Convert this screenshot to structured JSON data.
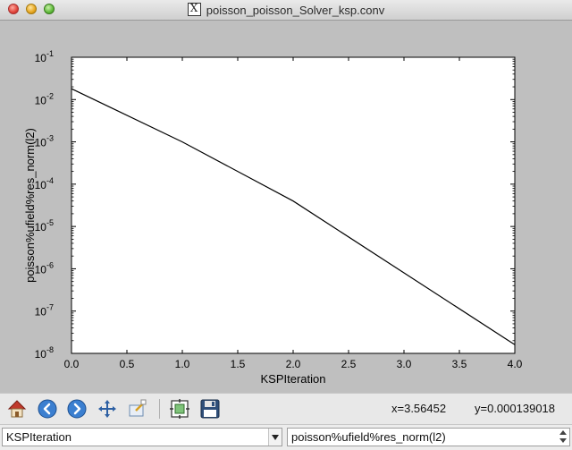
{
  "window": {
    "title": "poisson_poisson_Solver_ksp.conv"
  },
  "toolbar": {
    "coord_x": "x=3.56452",
    "coord_y": "y=0.000139018",
    "tools": [
      "home-icon",
      "back-icon",
      "forward-icon",
      "pan-icon",
      "zoom-icon",
      "configure-subplots-icon",
      "save-icon"
    ]
  },
  "selectors": {
    "x_field": "KSPIteration",
    "y_field": "poisson%ufield%res_norm(l2)"
  },
  "chart_data": {
    "type": "line",
    "xlabel": "KSPIteration",
    "ylabel": "poisson%ufield%res_norm(l2)",
    "xlim": [
      0.0,
      4.0
    ],
    "ylim": [
      1e-08,
      0.1
    ],
    "yscale": "log",
    "grid": false,
    "x_ticks": [
      "0.0",
      "0.5",
      "1.0",
      "1.5",
      "2.0",
      "2.5",
      "3.0",
      "3.5",
      "4.0"
    ],
    "y_ticks": [
      {
        "base": "10",
        "exp": "-8"
      },
      {
        "base": "10",
        "exp": "-7"
      },
      {
        "base": "10",
        "exp": "-6"
      },
      {
        "base": "10",
        "exp": "-5"
      },
      {
        "base": "10",
        "exp": "-4"
      },
      {
        "base": "10",
        "exp": "-3"
      },
      {
        "base": "10",
        "exp": "-2"
      },
      {
        "base": "10",
        "exp": "-1"
      }
    ],
    "series": [
      {
        "x": [
          0,
          1,
          2,
          3,
          4
        ],
        "y": [
          0.018,
          0.001,
          4e-05,
          8e-07,
          1.6e-08
        ],
        "color": "#000000"
      }
    ]
  }
}
